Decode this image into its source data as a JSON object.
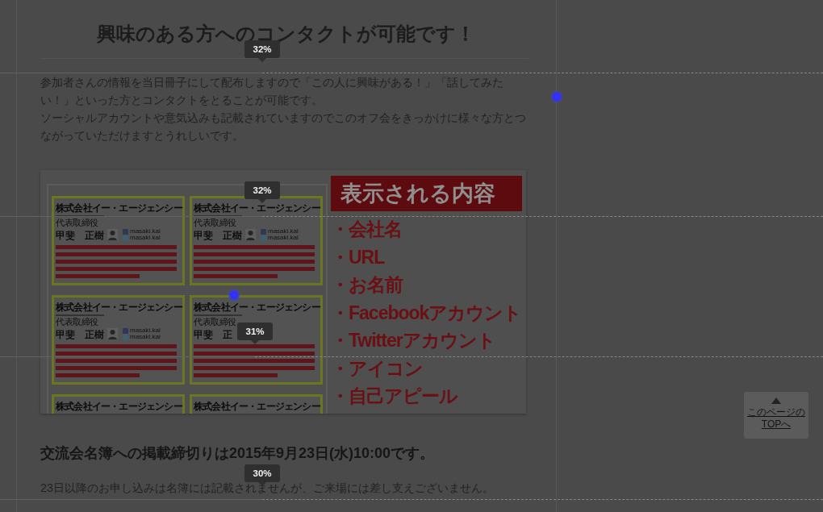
{
  "page": {
    "heading": "興味のある方へのコンタクトが可能です！",
    "paragraphs": [
      "参加者さんの情報を当日冊子にして配布しますので「この人に興味がある！」「話してみたい！」といった方とコンタクトをとることが可能です。",
      "ソーシャルアカウントや意気込みも記載されていますのでこのオフ会をきっかけに様々な方とつながっていただけますとうれしいです。"
    ],
    "figure": {
      "cards": [
        {
          "kind": "full",
          "company": "株式会社イー・エージェンシー",
          "title": "代表取締役",
          "name": "甲斐　正樹",
          "accounts": [
            {
              "kind": "facebook",
              "handle": "masaki.kai"
            },
            {
              "kind": "twitter",
              "handle": "masaki.kai"
            }
          ]
        },
        {
          "kind": "full",
          "company": "株式会社イー・エージェンシー",
          "title": "代表取締役",
          "name": "甲斐　正樹",
          "accounts": [
            {
              "kind": "facebook",
              "handle": "masaki.kai"
            },
            {
              "kind": "twitter",
              "handle": "masaki.kai"
            }
          ]
        },
        {
          "kind": "full",
          "company": "株式会社イー・エージェンシー",
          "title": "代表取締役",
          "name": "甲斐　正樹",
          "accounts": [
            {
              "kind": "facebook",
              "handle": "masaki.kai"
            },
            {
              "kind": "twitter",
              "handle": "masaki.kai"
            }
          ]
        },
        {
          "kind": "covered",
          "company": "株式会社イー・エージェンシー",
          "title": "代表取締役",
          "name": "甲斐　正"
        },
        {
          "kind": "cut",
          "company": "株式会社イー・エージェンシー"
        },
        {
          "kind": "cut",
          "company": "株式会社イー・エージェンシー"
        }
      ],
      "panel": {
        "title": "表示される内容",
        "items": [
          "・会社名",
          "・URL",
          "・お名前",
          "・Facebookアカウント",
          "・Twitterアカウント",
          "・アイコン",
          "・自己アピール"
        ]
      }
    },
    "deadline": "交流会名簿への掲載締切りは2015年9月23日(水)10:00です。",
    "note": "23日以降のお申し込みは名簿には記載されませんが、ご来場には差し支えございません。"
  },
  "scroll_markers": [
    {
      "label": "32%"
    },
    {
      "label": "32%"
    },
    {
      "label": "31%"
    },
    {
      "label": "30%"
    }
  ],
  "back_to_top": {
    "lines": [
      "このページの",
      "TOPへ"
    ]
  }
}
